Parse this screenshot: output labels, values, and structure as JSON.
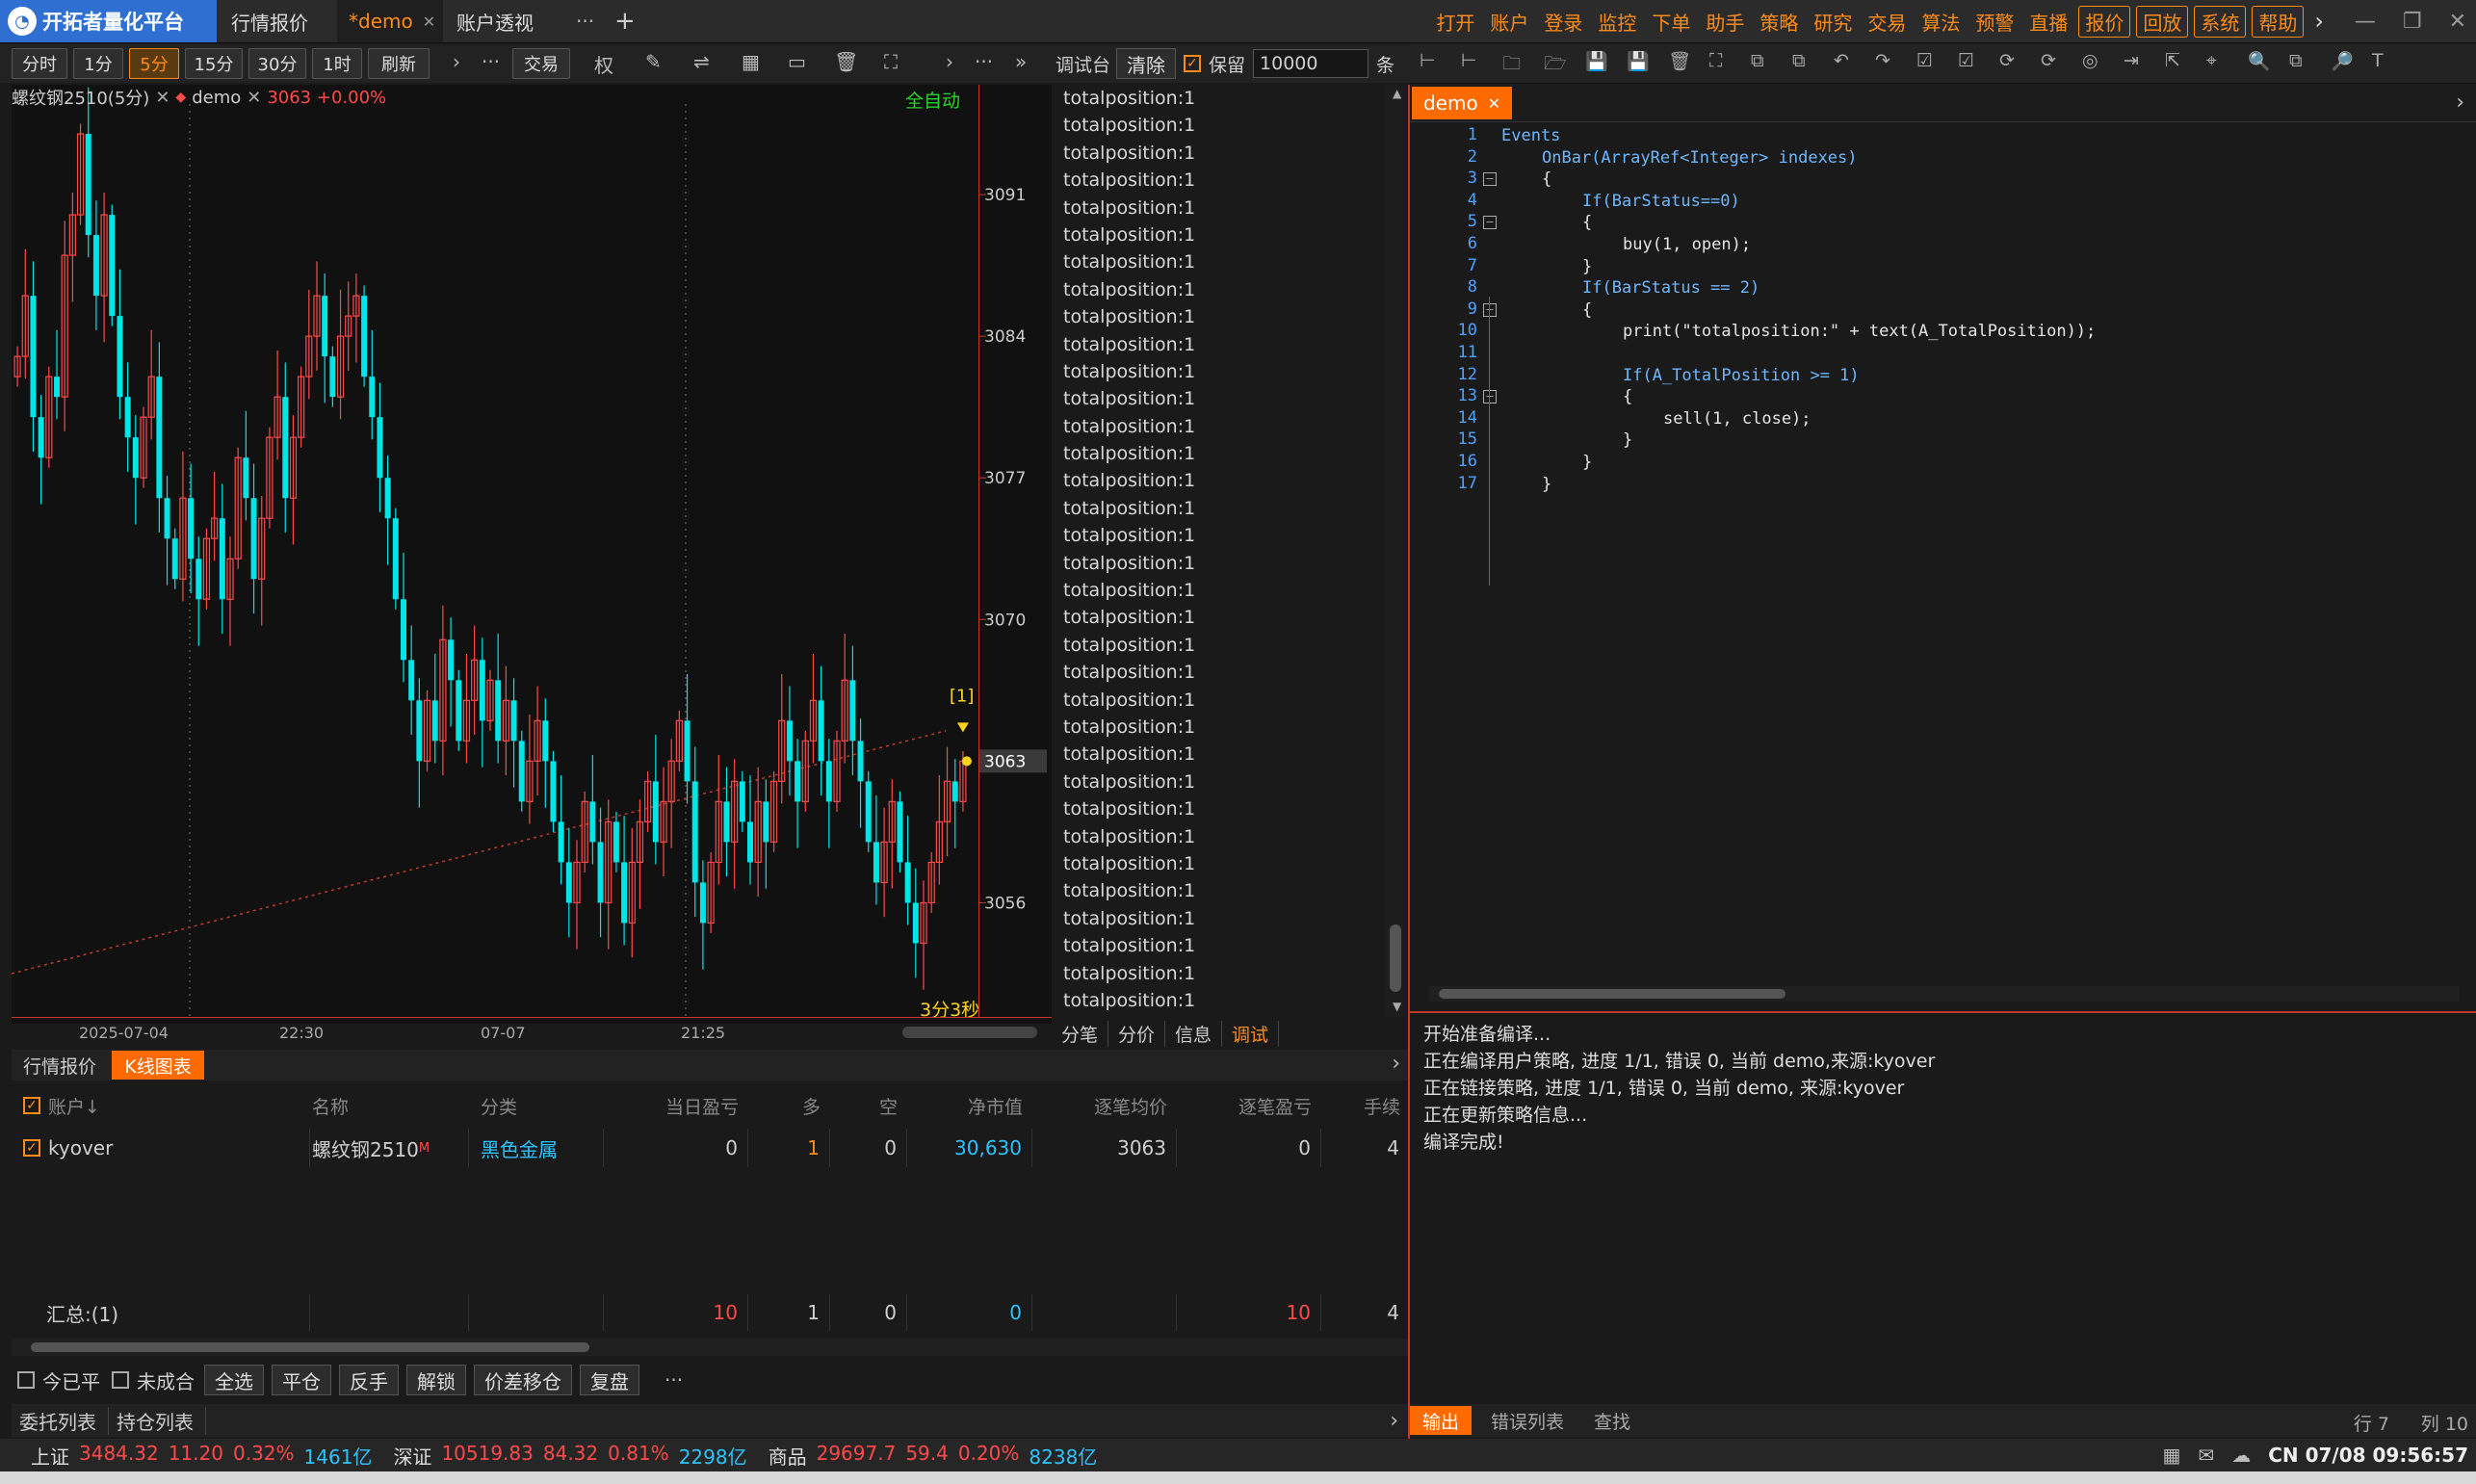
{
  "app": {
    "title": "开拓者量化平台",
    "tabs": [
      {
        "label": "行情报价",
        "active": false
      },
      {
        "label": "*demo",
        "active": true
      },
      {
        "label": "账户透视",
        "active": false
      }
    ],
    "more_glyph": "···",
    "add_glyph": "+",
    "menu": [
      {
        "label": "打开"
      },
      {
        "label": "账户"
      },
      {
        "label": "登录"
      },
      {
        "label": "监控"
      },
      {
        "label": "下单"
      },
      {
        "label": "助手"
      },
      {
        "label": "策略"
      },
      {
        "label": "研究"
      },
      {
        "label": "交易"
      },
      {
        "label": "算法"
      },
      {
        "label": "预警"
      },
      {
        "label": "直播"
      },
      {
        "label": "报价",
        "boxed": true
      },
      {
        "label": "回放",
        "boxed": true
      },
      {
        "label": "系统",
        "boxed": true
      },
      {
        "label": "帮助",
        "boxed": true
      }
    ],
    "menu_more": "›"
  },
  "chart_toolbar": {
    "periods": [
      "分时",
      "1分",
      "5分",
      "15分",
      "30分",
      "1时",
      "刷新"
    ],
    "selected": "5分",
    "trade_label": "交易",
    "rights_label": "权"
  },
  "chart": {
    "instrument": "螺纹钢2510(5分)",
    "strategy": "demo",
    "price_info": "3063 +0.00%",
    "mode": "全自动",
    "countdown": "3分3秒",
    "signal_label": "[1]",
    "current_price": "3063"
  },
  "chart_data": {
    "type": "candlestick",
    "x_ticks": [
      "2025-07-04",
      "22:30",
      "07-07",
      "21:25"
    ],
    "y_ticks": [
      3091,
      3084,
      3077,
      3070,
      3063,
      3056
    ],
    "ylim": [
      3050.5,
      3095
    ],
    "closes": [
      3083,
      3086,
      3080,
      3078,
      3082,
      3081,
      3088,
      3090,
      3094,
      3089,
      3086,
      3090,
      3085,
      3081,
      3079,
      3077,
      3080,
      3082,
      3076,
      3074,
      3072,
      3076,
      3073,
      3071,
      3074,
      3075,
      3071,
      3073,
      3078,
      3076,
      3072,
      3075,
      3079,
      3081,
      3076,
      3079,
      3082,
      3084,
      3086,
      3083,
      3081,
      3084,
      3085,
      3086,
      3082,
      3080,
      3077,
      3075,
      3071,
      3068,
      3066,
      3063,
      3066,
      3064,
      3069,
      3067,
      3064,
      3066,
      3068,
      3065,
      3067,
      3064,
      3066,
      3064,
      3061,
      3063,
      3065,
      3063,
      3060,
      3058,
      3056,
      3058,
      3061,
      3059,
      3056,
      3060,
      3058,
      3055,
      3058,
      3060,
      3062,
      3059,
      3061,
      3063,
      3065,
      3062,
      3057,
      3055,
      3058,
      3061,
      3059,
      3062,
      3060,
      3058,
      3061,
      3059,
      3062,
      3065,
      3063,
      3061,
      3064,
      3066,
      3063,
      3061,
      3064,
      3067,
      3064,
      3062,
      3059,
      3057,
      3059,
      3061,
      3058,
      3056,
      3054,
      3056,
      3058,
      3060,
      3062,
      3061,
      3063
    ],
    "trendline": [
      3052.5,
      3064.5
    ]
  },
  "debug": {
    "title": "调试台",
    "clear_label": "清除",
    "keep_label": "保留",
    "keep_value": "10000",
    "unit_label": "条",
    "lines": [
      "totalposition:1",
      "totalposition:1",
      "totalposition:1",
      "totalposition:1",
      "totalposition:1",
      "totalposition:1",
      "totalposition:1",
      "totalposition:1",
      "totalposition:1",
      "totalposition:1",
      "totalposition:1",
      "totalposition:1",
      "totalposition:1",
      "totalposition:1",
      "totalposition:1",
      "totalposition:1",
      "totalposition:1",
      "totalposition:1",
      "totalposition:1",
      "totalposition:1",
      "totalposition:1",
      "totalposition:1",
      "totalposition:1",
      "totalposition:1",
      "totalposition:1",
      "totalposition:1",
      "totalposition:1",
      "totalposition:1",
      "totalposition:1",
      "totalposition:1",
      "totalposition:1",
      "totalposition:1",
      "totalposition:1",
      "totalposition:1"
    ],
    "tabs": [
      {
        "label": "分笔"
      },
      {
        "label": "分价"
      },
      {
        "label": "信息"
      },
      {
        "label": "调试",
        "active": true
      }
    ]
  },
  "editor": {
    "tab_label": "demo",
    "lines": [
      {
        "n": "1",
        "indent": 0,
        "text": "Events"
      },
      {
        "n": "2",
        "indent": 1,
        "text": "OnBar(ArrayRef<Integer> indexes)"
      },
      {
        "n": "3",
        "indent": 1,
        "text": "{"
      },
      {
        "n": "4",
        "indent": 2,
        "text": "If(BarStatus==0)"
      },
      {
        "n": "5",
        "indent": 2,
        "text": "{"
      },
      {
        "n": "6",
        "indent": 3,
        "text": "buy(1, open);"
      },
      {
        "n": "7",
        "indent": 2,
        "text": "}"
      },
      {
        "n": "8",
        "indent": 2,
        "text": "If(BarStatus == 2)"
      },
      {
        "n": "9",
        "indent": 2,
        "text": "{"
      },
      {
        "n": "10",
        "indent": 3,
        "text": "print(\"totalposition:\" + text(A_TotalPosition));"
      },
      {
        "n": "11",
        "indent": 3,
        "text": ""
      },
      {
        "n": "12",
        "indent": 3,
        "text": "If(A_TotalPosition >= 1)"
      },
      {
        "n": "13",
        "indent": 3,
        "text": "{"
      },
      {
        "n": "14",
        "indent": 4,
        "text": "sell(1, close);"
      },
      {
        "n": "15",
        "indent": 3,
        "text": "}"
      },
      {
        "n": "16",
        "indent": 2,
        "text": "}"
      },
      {
        "n": "17",
        "indent": 1,
        "text": "}"
      }
    ]
  },
  "output": {
    "lines": [
      "开始准备编译...",
      "正在编译用户策略, 进度 1/1, 错误 0, 当前 demo,来源:kyover",
      "正在链接策略, 进度 1/1, 错误 0, 当前 demo, 来源:kyover",
      "正在更新策略信息...",
      "编译完成!"
    ],
    "tabs": [
      {
        "label": "输出",
        "active": true
      },
      {
        "label": "错误列表"
      },
      {
        "label": "查找"
      }
    ],
    "cursor_row": "行 7",
    "cursor_col": "列 10"
  },
  "grid": {
    "tabs": [
      {
        "label": "行情报价"
      },
      {
        "label": "K线图表",
        "active": true
      }
    ],
    "headers": {
      "account": "账户↓",
      "name": "名称",
      "category": "分类",
      "daily_pnl": "当日盈亏",
      "long": "多",
      "short": "空",
      "market_value": "净市值",
      "avg_price": "逐笔均价",
      "pnl": "逐笔盈亏",
      "lots": "手续"
    },
    "row": {
      "account": "kyover",
      "name": "螺纹钢2510",
      "name_badge": "M",
      "category": "黑色金属",
      "daily_pnl": "0",
      "long": "1",
      "short": "0",
      "market_value": "30,630",
      "avg_price": "3063",
      "pnl": "0",
      "lots": "4"
    },
    "summary": {
      "label": "汇总:(1)",
      "daily_pnl": "10",
      "long": "1",
      "short": "0",
      "market_value": "0",
      "pnl": "10",
      "lots": "4"
    }
  },
  "actions": {
    "today_closed": "今已平",
    "unfilled": "未成合",
    "buttons": [
      "全选",
      "平仓",
      "反手",
      "解锁",
      "价差移仓",
      "复盘"
    ],
    "more": "···"
  },
  "order_tabs": [
    {
      "label": "委托列表"
    },
    {
      "label": "持仓列表"
    }
  ],
  "status": {
    "indices": [
      {
        "name": "上证",
        "value": "3484.32",
        "change": "11.20",
        "pct": "0.32%",
        "volume": "1461亿"
      },
      {
        "name": "深证",
        "value": "10519.83",
        "change": "84.32",
        "pct": "0.81%",
        "volume": "2298亿"
      },
      {
        "name": "商品",
        "value": "29697.7",
        "change": "59.4",
        "pct": "0.20%",
        "volume": "8238亿"
      }
    ],
    "datetime": "CN 07/08 09:56:57"
  }
}
